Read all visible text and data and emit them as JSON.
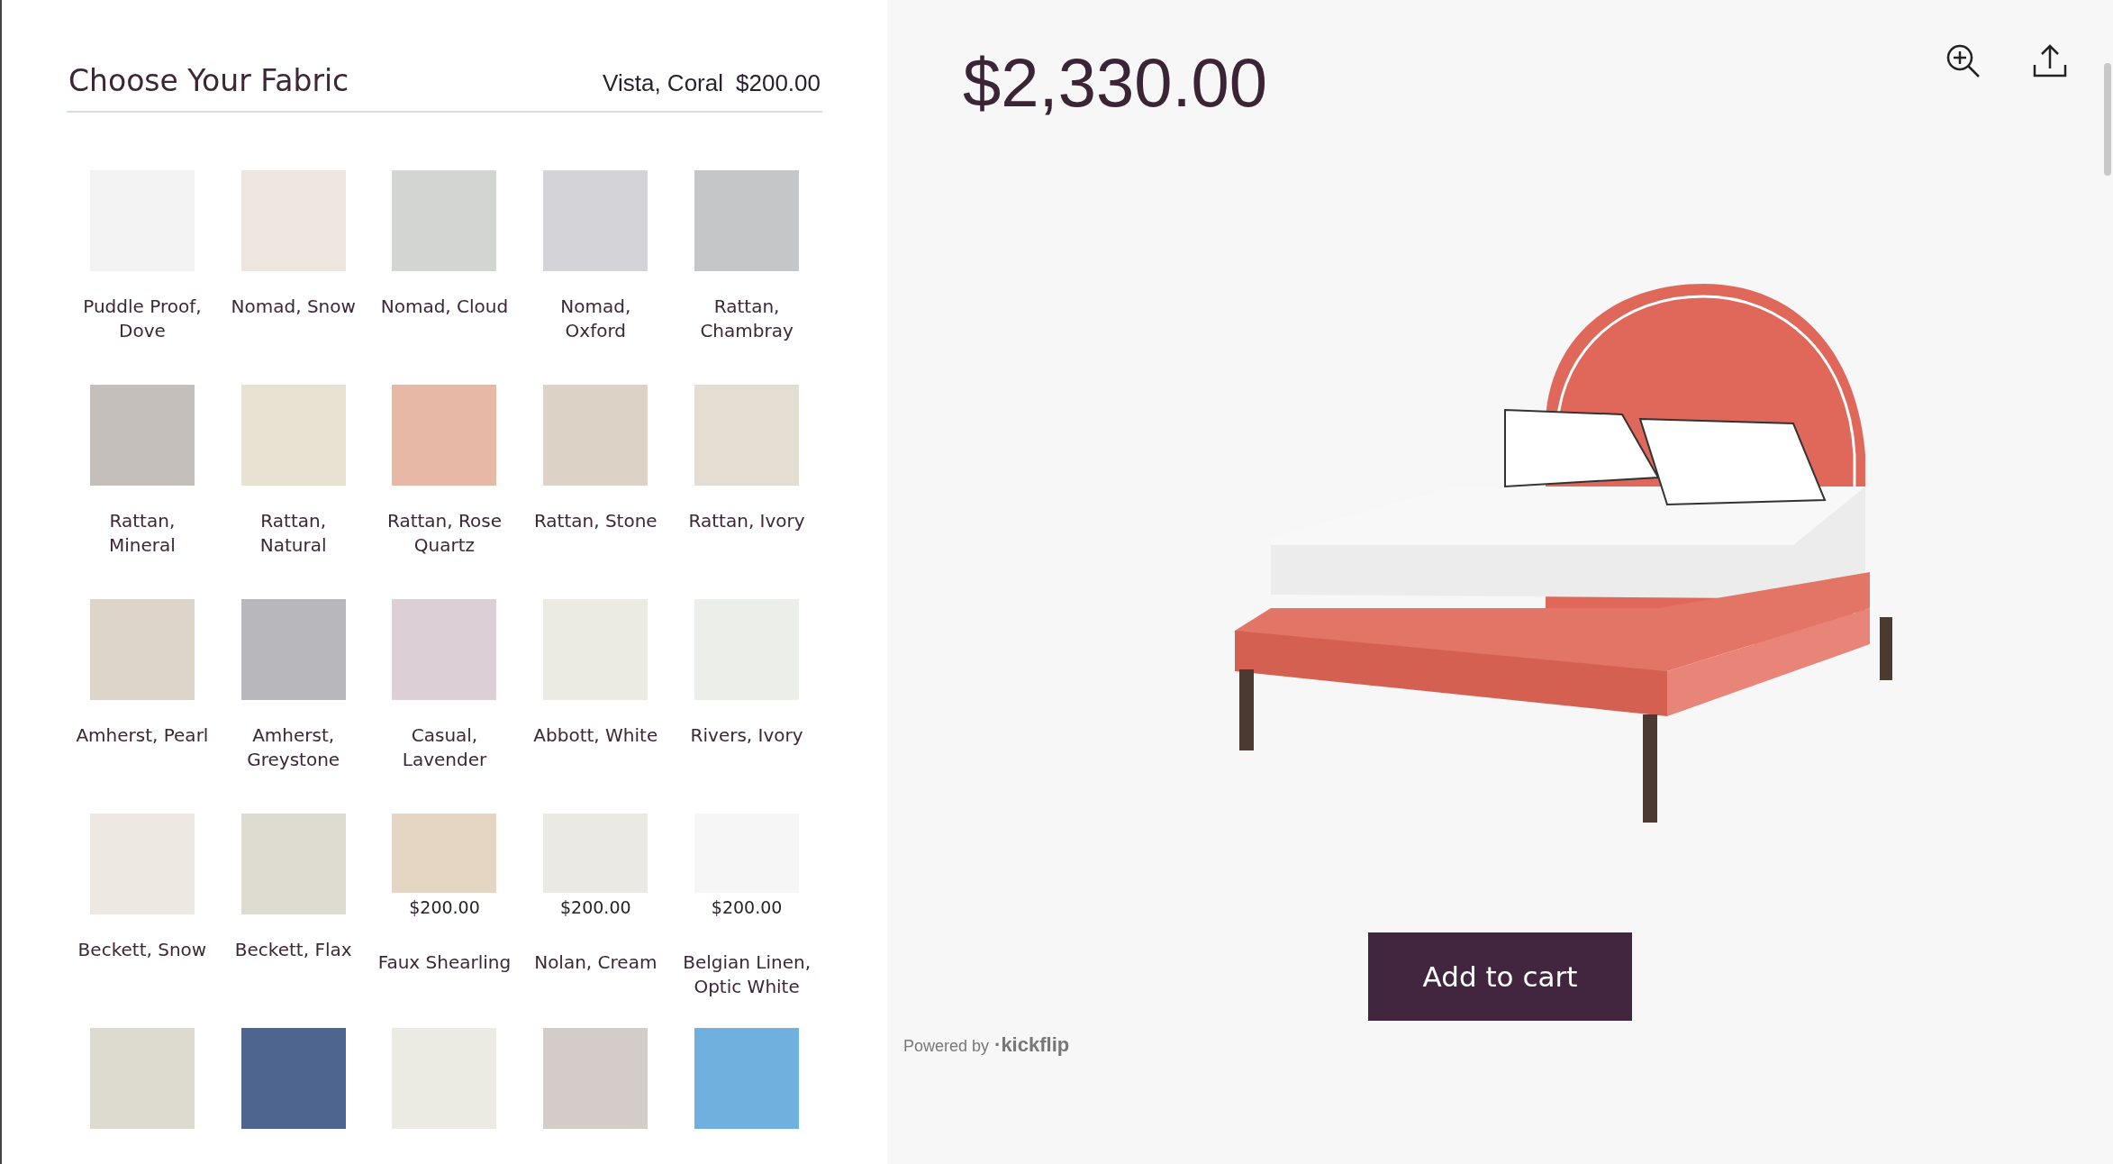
{
  "fabric_panel": {
    "title": "Choose Your Fabric",
    "selected_name": "Vista, Coral",
    "selected_price": "$200.00",
    "swatches": [
      {
        "name": "Puddle Proof, Dove",
        "color": "#f3f3f3"
      },
      {
        "name": "Nomad, Snow",
        "color": "#ece6de"
      },
      {
        "name": "Nomad, Cloud",
        "color": "#d3d5d3"
      },
      {
        "name": "Nomad, Oxford",
        "color": "#d4d4d8"
      },
      {
        "name": "Rattan, Chambray",
        "color": "#c4c6c8"
      },
      {
        "name": "Rattan, Mineral",
        "color": "#c4bfba"
      },
      {
        "name": "Rattan, Natural",
        "color": "#e8e2d2"
      },
      {
        "name": "Rattan, Rose Quartz",
        "color": "#e8b8a6"
      },
      {
        "name": "Rattan, Stone",
        "color": "#dcd2c6"
      },
      {
        "name": "Rattan, Ivory",
        "color": "#e4ddd2"
      },
      {
        "name": "Amherst, Pearl",
        "color": "#ddd5ca"
      },
      {
        "name": "Amherst, Greystone",
        "color": "#b8b8bc"
      },
      {
        "name": "Casual, Lavender",
        "color": "#ddcfd6"
      },
      {
        "name": "Abbott, White",
        "color": "#ecebe2"
      },
      {
        "name": "Rivers, Ivory",
        "color": "#eceeea"
      },
      {
        "name": "Beckett, Snow",
        "color": "#eee8e2"
      },
      {
        "name": "Beckett, Flax",
        "color": "#dedbd0"
      },
      {
        "name": "Faux Shearling",
        "price": "$200.00",
        "color": "#e4d6c2"
      },
      {
        "name": "Nolan, Cream",
        "price": "$200.00",
        "color": "#ebe9e3"
      },
      {
        "name": "Belgian Linen, Optic White",
        "price": "$200.00",
        "color": "#f6f6f6"
      },
      {
        "color": "#dddbd0"
      },
      {
        "color": "#4e6590"
      },
      {
        "color": "#ebebe4"
      },
      {
        "color": "#d4ccc8"
      },
      {
        "color": "#6fb0de"
      }
    ]
  },
  "preview": {
    "total_price": "$2,330.00",
    "add_to_cart": "Add to cart",
    "powered_by": "Powered by",
    "brand": "·kickflip"
  }
}
